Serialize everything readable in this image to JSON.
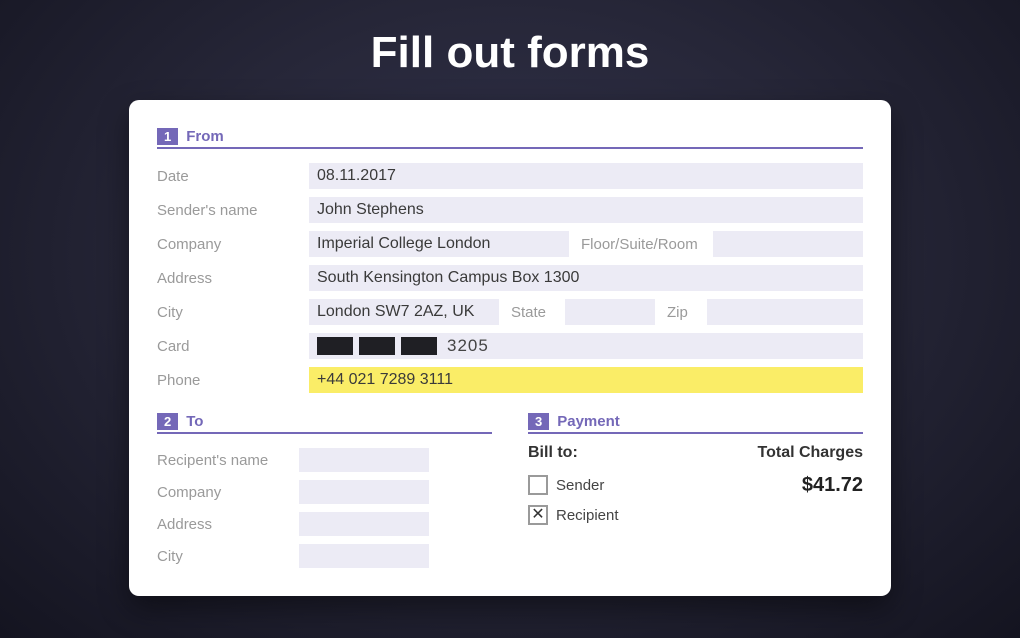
{
  "page_title": "Fill out forms",
  "sections": {
    "from": {
      "num": "1",
      "title": "From"
    },
    "to": {
      "num": "2",
      "title": "To"
    },
    "pay": {
      "num": "3",
      "title": "Payment"
    }
  },
  "from": {
    "labels": {
      "date": "Date",
      "sender": "Sender's name",
      "company": "Company",
      "floor": "Floor/Suite/Room",
      "address": "Address",
      "city": "City",
      "state": "State",
      "zip": "Zip",
      "card": "Card",
      "phone": "Phone"
    },
    "values": {
      "date": "08.11.2017",
      "sender": "John Stephens",
      "company": "Imperial College London",
      "floor": "",
      "address": "South Kensington Campus Box 1300",
      "city": "London SW7 2AZ, UK",
      "state": "",
      "zip": "",
      "card_last4": "3205",
      "phone": "+44 021 7289 3111"
    }
  },
  "to": {
    "labels": {
      "name": "Recipent's name",
      "company": "Company",
      "address": "Address",
      "city": "City"
    },
    "values": {
      "name": "",
      "company": "",
      "address": "",
      "city": ""
    }
  },
  "payment": {
    "bill_to_label": "Bill to:",
    "total_label": "Total Charges",
    "options": {
      "sender": "Sender",
      "recipient": "Recipient"
    },
    "selected": "recipient",
    "total": "$41.72"
  }
}
